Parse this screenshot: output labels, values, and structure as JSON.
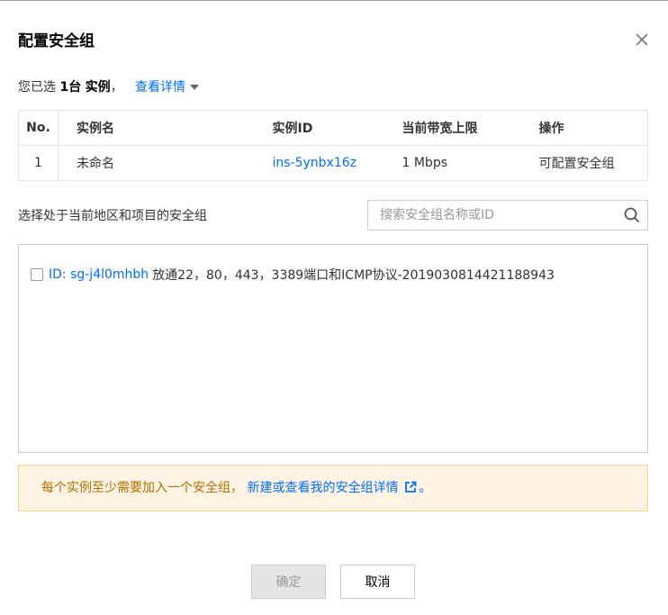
{
  "dialog": {
    "title": "配置安全组",
    "close_icon": "close-icon"
  },
  "selection": {
    "prefix": "您已选",
    "count_text": "1台",
    "unit_text": "实例",
    "separator": "，",
    "details_link": "查看详情"
  },
  "instance_table": {
    "headers": [
      "No.",
      "实例名",
      "实例ID",
      "当前带宽上限",
      "操作"
    ],
    "rows": [
      {
        "no": "1",
        "name": "未命名",
        "id": "ins-5ynbx16z",
        "bandwidth": "1 Mbps",
        "action": "可配置安全组"
      }
    ]
  },
  "security_group_picker": {
    "label": "选择处于当前地区和项目的安全组",
    "search_placeholder": "搜索安全组名称或ID",
    "search_icon": "search-icon",
    "items": [
      {
        "checked": false,
        "id_label": "ID: sg-j4l0mhbh",
        "description": "放通22，80，443，3389端口和ICMP协议-20190308144211889​43"
      }
    ]
  },
  "notice": {
    "text": "每个实例至少需要加入一个安全组，",
    "link_text": "新建或查看我的安全组详情",
    "link_icon": "external-link-icon",
    "end_text": "。",
    "colors": {
      "background": "#fff4e3",
      "border": "#ffd18b",
      "text": "#b36e00"
    }
  },
  "footer": {
    "confirm_label": "确定",
    "cancel_label": "取消"
  },
  "colors": {
    "accent": "#006eff",
    "border": "#e5e5e5"
  }
}
